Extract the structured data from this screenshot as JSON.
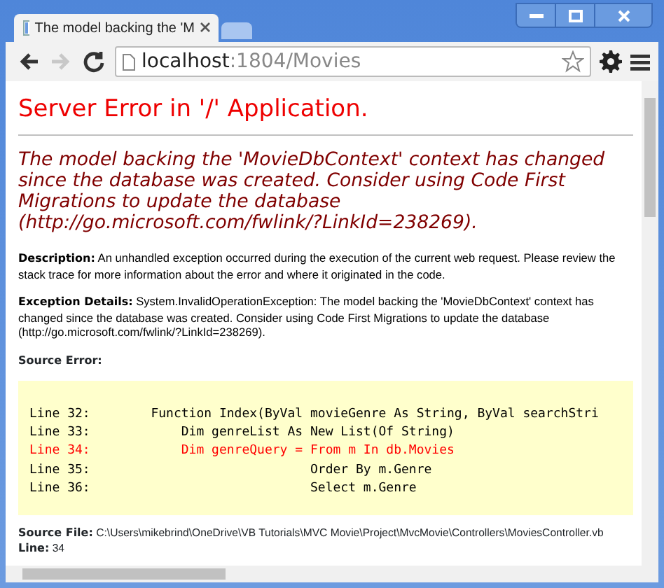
{
  "tabs": [
    {
      "title": "The model backing the 'M",
      "selected": true
    },
    {
      "selected": false
    }
  ],
  "nav_buttons": [
    {
      "kind": "back",
      "disabled": false
    },
    {
      "kind": "forward",
      "disabled": true
    },
    {
      "kind": "reload",
      "disabled": false
    }
  ],
  "address": {
    "host": "localhost",
    "path": ":1804/Movies"
  },
  "page": {
    "title": "Server Error in '/' Application.",
    "message": "The model backing the 'MovieDbContext' context has changed since the database was created. Consider using Code First Migrations to update the database (http://go.microsoft.com/fwlink/?LinkId=238269).",
    "description": "**Description:** An unhandled exception occurred during the execution of the current web request. Please review the stack trace for more information about the error and where it originated in the code.",
    "exception_details": "**Exception Details:** System.InvalidOperationException: The model backing the 'MovieDbContext' context has changed since the database was created. Consider using Code First Migrations to update the database (http://go.microsoft.com/fwlink/?LinkId=238269).",
    "source_error_label": "Source Error:",
    "source_lines": [
      {
        "text": "Line 32:        Function Index(ByVal movieGenre As String, ByVal searchStri",
        "error": false
      },
      {
        "text": "Line 33:            Dim genreList As New List(Of String)",
        "error": false
      },
      {
        "text": "Line 34:            Dim genreQuery = From m In db.Movies",
        "error": true
      },
      {
        "text": "Line 35:                             Order By m.Genre",
        "error": false
      },
      {
        "text": "Line 36:                             Select m.Genre",
        "error": false
      }
    ],
    "source_file": "**Source File:** C:\\Users\\mikebrind\\OneDrive\\VB Tutorials\\MVC Movie\\Project\\MvcMovie\\Controllers\\MoviesController.vb",
    "line": "**Line:** 34"
  }
}
